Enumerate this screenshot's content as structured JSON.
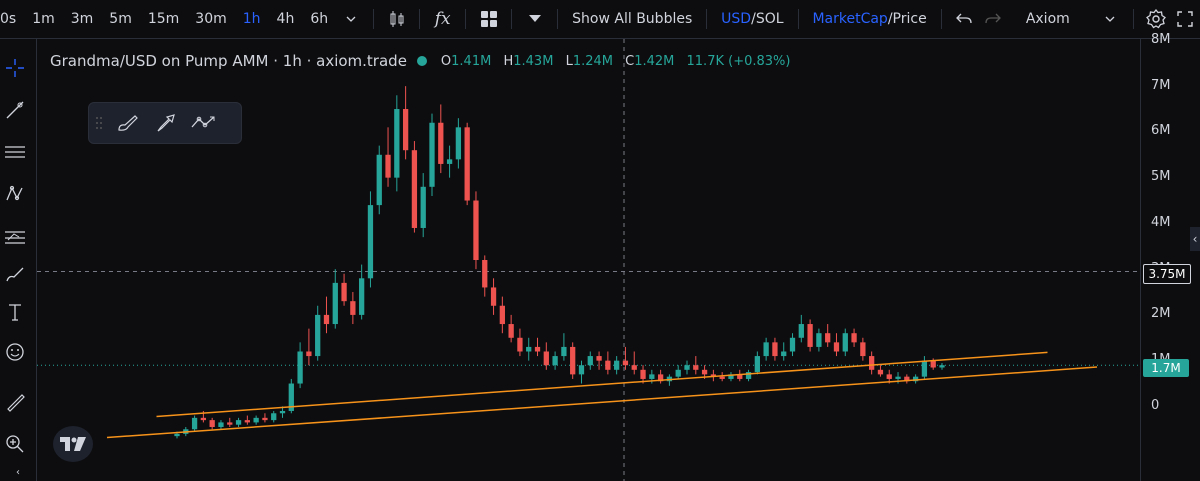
{
  "toolbar": {
    "timeframes": [
      "0s",
      "1m",
      "3m",
      "5m",
      "15m",
      "30m",
      "1h",
      "4h",
      "6h"
    ],
    "active_timeframe": "1h",
    "indicators_label": "fx",
    "bubbles_label": "Show All Bubbles",
    "currency_primary": "USD",
    "currency_sep": "/",
    "currency_secondary": "SOL",
    "metric_primary": "MarketCap",
    "metric_sep": "/",
    "metric_secondary": "Price",
    "brand_label": "Axiom"
  },
  "legend": {
    "title": "Grandma/USD on Pump AMM · 1h · axiom.trade",
    "o_key": "O",
    "o_val": "1.41M",
    "h_key": "H",
    "h_val": "1.43M",
    "l_key": "L",
    "l_val": "1.24M",
    "c_key": "C",
    "c_val": "1.42M",
    "change": "11.7K (+0.83%)"
  },
  "price_axis": {
    "labels": [
      "8M",
      "7M",
      "6M",
      "5M",
      "4M",
      "3M",
      "2M",
      "1M",
      "0"
    ],
    "crosshair_label": "3.75M",
    "last_price_label": "1.7M"
  },
  "colors": {
    "up": "#26a69a",
    "down": "#ef5350",
    "accent": "#2962ff",
    "trendline": "#f7931a"
  },
  "chart_data": {
    "type": "candlestick",
    "ylim": [
      0,
      8.6
    ],
    "unit": "M",
    "ohlc": [
      [
        0.15,
        0.25,
        0.1,
        0.2
      ],
      [
        0.2,
        0.35,
        0.15,
        0.3
      ],
      [
        0.3,
        0.6,
        0.25,
        0.55
      ],
      [
        0.55,
        0.7,
        0.45,
        0.5
      ],
      [
        0.5,
        0.55,
        0.3,
        0.35
      ],
      [
        0.35,
        0.5,
        0.3,
        0.45
      ],
      [
        0.45,
        0.55,
        0.35,
        0.4
      ],
      [
        0.4,
        0.55,
        0.35,
        0.5
      ],
      [
        0.5,
        0.6,
        0.4,
        0.45
      ],
      [
        0.45,
        0.6,
        0.4,
        0.55
      ],
      [
        0.55,
        0.65,
        0.45,
        0.5
      ],
      [
        0.5,
        0.7,
        0.45,
        0.65
      ],
      [
        0.65,
        0.8,
        0.55,
        0.7
      ],
      [
        0.7,
        1.4,
        0.65,
        1.3
      ],
      [
        1.3,
        2.2,
        1.2,
        2.0
      ],
      [
        2.0,
        2.5,
        1.7,
        1.9
      ],
      [
        1.9,
        3.0,
        1.8,
        2.8
      ],
      [
        2.8,
        3.2,
        2.4,
        2.6
      ],
      [
        2.6,
        3.8,
        2.5,
        3.5
      ],
      [
        3.5,
        3.7,
        3.0,
        3.1
      ],
      [
        3.1,
        3.3,
        2.6,
        2.8
      ],
      [
        2.8,
        3.9,
        2.7,
        3.6
      ],
      [
        3.6,
        5.5,
        3.4,
        5.2
      ],
      [
        5.2,
        6.5,
        5.0,
        6.3
      ],
      [
        6.3,
        6.9,
        5.6,
        5.8
      ],
      [
        5.8,
        7.6,
        5.5,
        7.3
      ],
      [
        7.3,
        7.8,
        6.2,
        6.4
      ],
      [
        6.4,
        6.6,
        4.6,
        4.7
      ],
      [
        4.7,
        5.9,
        4.5,
        5.6
      ],
      [
        5.6,
        7.2,
        5.4,
        7.0
      ],
      [
        7.0,
        7.4,
        5.9,
        6.1
      ],
      [
        6.1,
        6.5,
        5.8,
        6.2
      ],
      [
        6.2,
        7.1,
        6.0,
        6.9
      ],
      [
        6.9,
        7.0,
        5.2,
        5.3
      ],
      [
        5.3,
        5.5,
        3.8,
        4.0
      ],
      [
        4.0,
        4.1,
        3.2,
        3.4
      ],
      [
        3.4,
        3.6,
        2.8,
        3.0
      ],
      [
        3.0,
        3.2,
        2.4,
        2.6
      ],
      [
        2.6,
        2.8,
        2.2,
        2.3
      ],
      [
        2.3,
        2.5,
        1.9,
        2.0
      ],
      [
        2.0,
        2.3,
        1.8,
        2.1
      ],
      [
        2.1,
        2.3,
        1.9,
        2.0
      ],
      [
        2.0,
        2.2,
        1.6,
        1.7
      ],
      [
        1.7,
        2.0,
        1.6,
        1.9
      ],
      [
        1.9,
        2.4,
        1.8,
        2.1
      ],
      [
        2.1,
        2.2,
        1.4,
        1.5
      ],
      [
        1.5,
        1.8,
        1.3,
        1.7
      ],
      [
        1.7,
        2.0,
        1.6,
        1.9
      ],
      [
        1.9,
        2.0,
        1.6,
        1.8
      ],
      [
        1.8,
        2.0,
        1.5,
        1.6
      ],
      [
        1.6,
        1.9,
        1.5,
        1.8
      ],
      [
        1.8,
        2.1,
        1.6,
        1.7
      ],
      [
        1.7,
        2.0,
        1.5,
        1.6
      ],
      [
        1.6,
        1.7,
        1.3,
        1.4
      ],
      [
        1.4,
        1.6,
        1.3,
        1.5
      ],
      [
        1.5,
        1.6,
        1.3,
        1.35
      ],
      [
        1.35,
        1.5,
        1.25,
        1.45
      ],
      [
        1.45,
        1.7,
        1.4,
        1.6
      ],
      [
        1.6,
        1.8,
        1.5,
        1.7
      ],
      [
        1.7,
        1.9,
        1.5,
        1.6
      ],
      [
        1.6,
        1.7,
        1.4,
        1.5
      ],
      [
        1.5,
        1.6,
        1.35,
        1.45
      ],
      [
        1.45,
        1.55,
        1.35,
        1.4
      ],
      [
        1.4,
        1.55,
        1.35,
        1.5
      ],
      [
        1.5,
        1.6,
        1.35,
        1.4
      ],
      [
        1.4,
        1.6,
        1.35,
        1.55
      ],
      [
        1.55,
        2.0,
        1.5,
        1.9
      ],
      [
        1.9,
        2.3,
        1.8,
        2.2
      ],
      [
        2.2,
        2.3,
        1.8,
        1.9
      ],
      [
        1.9,
        2.2,
        1.8,
        2.0
      ],
      [
        2.0,
        2.4,
        1.9,
        2.3
      ],
      [
        2.3,
        2.8,
        2.2,
        2.6
      ],
      [
        2.6,
        2.7,
        2.0,
        2.1
      ],
      [
        2.1,
        2.5,
        2.0,
        2.4
      ],
      [
        2.4,
        2.6,
        2.1,
        2.2
      ],
      [
        2.2,
        2.4,
        1.9,
        2.0
      ],
      [
        2.0,
        2.5,
        1.9,
        2.4
      ],
      [
        2.4,
        2.5,
        2.1,
        2.2
      ],
      [
        2.2,
        2.3,
        1.8,
        1.9
      ],
      [
        1.9,
        2.0,
        1.5,
        1.6
      ],
      [
        1.6,
        1.7,
        1.45,
        1.5
      ],
      [
        1.5,
        1.6,
        1.3,
        1.4
      ],
      [
        1.4,
        1.55,
        1.3,
        1.45
      ],
      [
        1.45,
        1.5,
        1.3,
        1.35
      ],
      [
        1.35,
        1.5,
        1.3,
        1.45
      ],
      [
        1.45,
        1.9,
        1.4,
        1.8
      ],
      [
        1.8,
        1.85,
        1.6,
        1.65
      ],
      [
        1.65,
        1.75,
        1.6,
        1.7
      ]
    ],
    "trendlines": [
      {
        "x1": 0.0,
        "y1": 0.12,
        "x2": 1.0,
        "y2": 1.66
      },
      {
        "x1": 0.05,
        "y1": 0.58,
        "x2": 0.95,
        "y2": 1.98
      }
    ]
  }
}
